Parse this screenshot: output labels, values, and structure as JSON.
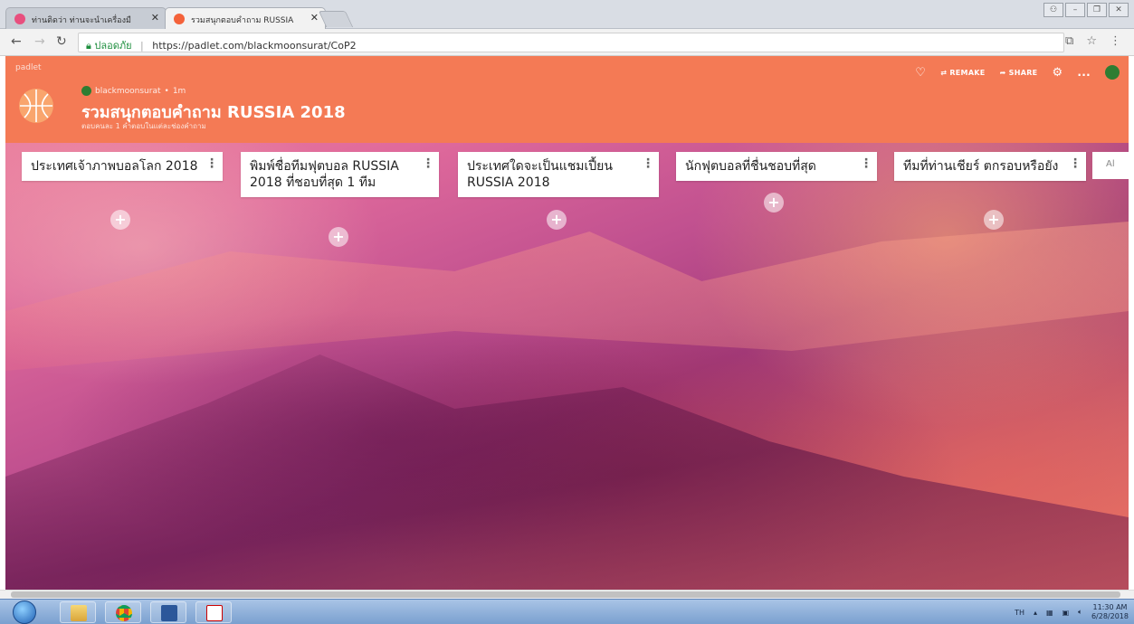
{
  "browser": {
    "tabs": [
      {
        "title": "ท่านติดว่า ท่านจะนำเครื่องมื",
        "active": false
      },
      {
        "title": "รวมสนุกตอบคำถาม RUSSIA",
        "active": true
      }
    ],
    "address": {
      "secure_label": "ปลอดภัย",
      "url": "https://padlet.com/blackmoonsurat/CoP2"
    }
  },
  "padlet": {
    "brand": "padlet",
    "author": "blackmoonsurat",
    "time_ago": "1m",
    "title": "รวมสนุกตอบคำถาม RUSSIA 2018",
    "subtitle": "ตอบคนละ 1 คำตอบในแต่ละช่องคำถาม",
    "actions": {
      "remake": "REMAKE",
      "share": "SHARE",
      "more": "..."
    },
    "columns": [
      {
        "title": "ประเทศเจ้าภาพบอลโลก 2018"
      },
      {
        "title": "พิมพ์ชื่อทีมฟุตบอล RUSSIA 2018 ที่ชอบที่สุด 1 ทีม"
      },
      {
        "title": "ประเทศใดจะเป็นแชมเปี้ยน RUSSIA 2018"
      },
      {
        "title": "นักฟุตบอลที่ชื่นชอบที่สุด"
      },
      {
        "title": "ทีมที่ท่านเชียร์ ตกรอบหรือยัง"
      }
    ],
    "next_column_peek": "Al",
    "add_symbol": "+",
    "menu_symbol": "⋮"
  },
  "taskbar": {
    "language": "TH",
    "time": "11:30 AM",
    "date": "6/28/2018"
  },
  "colors": {
    "header": "#f47a55",
    "secure": "#1e8e3e"
  }
}
